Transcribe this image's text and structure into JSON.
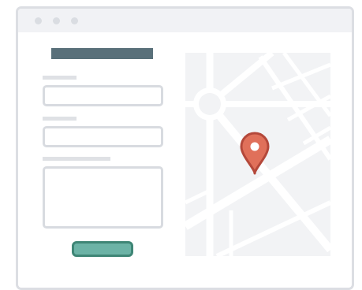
{
  "window": {
    "controls": [
      "close",
      "minimize",
      "maximize"
    ]
  },
  "form": {
    "title": "",
    "fields": [
      {
        "label": "",
        "value": "",
        "placeholder": ""
      },
      {
        "label": "",
        "value": "",
        "placeholder": ""
      },
      {
        "label": "",
        "value": "",
        "placeholder": ""
      }
    ],
    "submit_label": ""
  },
  "map": {
    "pin_icon": "map-pin-icon",
    "colors": {
      "land": "#f2f3f5",
      "road": "#ffffff",
      "pin": "#e0705a",
      "pin_outline": "#b4483a"
    }
  },
  "colors": {
    "title_bar": "#59707a",
    "button_fill": "#6cb3a6",
    "button_border": "#3f8676",
    "field_border": "#d8dbe0"
  }
}
